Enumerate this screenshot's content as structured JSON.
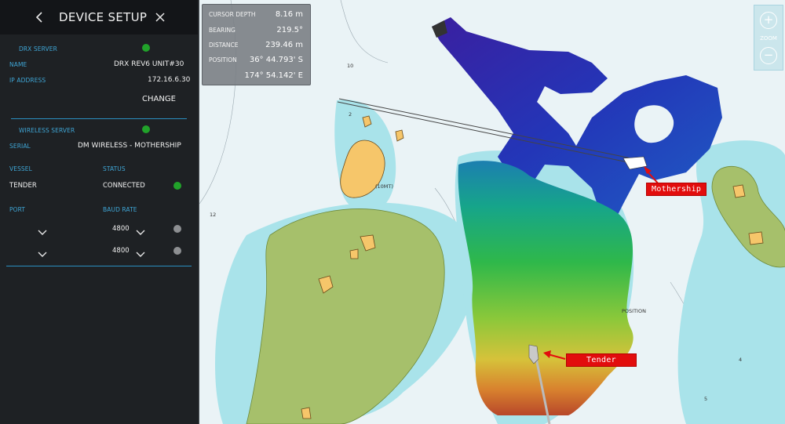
{
  "panel": {
    "title": "DEVICE SETUP",
    "drx_server_label": "DRX SERVER",
    "name_label": "NAME",
    "name_value": "DRX REV6 UNIT#30",
    "ip_label": "IP ADDRESS",
    "ip_value": "172.16.6.30",
    "change_label": "CHANGE",
    "wireless_server_label": "WIRELESS SERVER",
    "serial_label": "SERIAL",
    "serial_value": "DM WIRELESS - MOTHERSHIP",
    "vessel_label": "VESSEL",
    "vessel_value": "TENDER",
    "status_label": "STATUS",
    "status_value": "CONNECTED",
    "port_label": "PORT",
    "baud_label": "BAUD RATE",
    "rows": [
      {
        "baud": "4800"
      },
      {
        "baud": "4800"
      }
    ],
    "colors": {
      "accent": "#3fa6d6",
      "ok": "#21a22a",
      "idle": "#8d8f92"
    }
  },
  "readout": {
    "depth_label": "CURSOR DEPTH",
    "depth_value": "8.16 m",
    "bearing_label": "BEARING",
    "bearing_value": "219.5°",
    "distance_label": "DISTANCE",
    "distance_value": "239.46 m",
    "position_label": "POSITION",
    "lat_value": "36° 44.793' S",
    "lon_value": "174° 54.142' E"
  },
  "zoom": {
    "label": "ZOOM",
    "in_icon": "+",
    "out_icon": "−"
  },
  "map": {
    "mothership_label": "Mothership",
    "tender_label": "Tender",
    "depth_marks": [
      "10",
      "2",
      "12",
      "(10MT)",
      "POSITION",
      "4",
      "5"
    ]
  }
}
